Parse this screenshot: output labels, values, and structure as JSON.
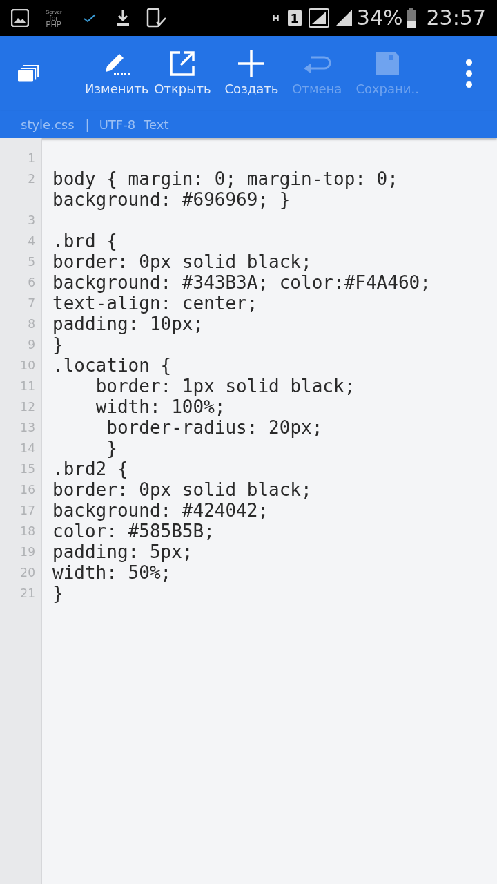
{
  "status_bar": {
    "notification_label": [
      "Server",
      "for",
      "PHP"
    ],
    "network_type": "H",
    "sim": "1",
    "battery": "34%",
    "time": "23:57"
  },
  "toolbar": {
    "actions": [
      {
        "kind": "edit",
        "label": "Изменить",
        "disabled": false
      },
      {
        "kind": "open",
        "label": "Открыть",
        "disabled": false
      },
      {
        "kind": "create",
        "label": "Создать",
        "disabled": false
      },
      {
        "kind": "undo",
        "label": "Отмена",
        "disabled": true
      },
      {
        "kind": "save",
        "label": "Сохрани..",
        "disabled": true
      }
    ]
  },
  "file_info": {
    "filename": "style.css",
    "separator": "|",
    "encoding": "UTF-8",
    "mode": "Text"
  },
  "editor": {
    "lines": [
      {
        "number": "1"
      },
      {
        "number": "2",
        "text": "body { margin: 0; margin-top: 0; background: #696969; }"
      },
      {
        "number": "3"
      },
      {
        "number": "4",
        "text": ".brd { "
      },
      {
        "number": "5",
        "text": "border: 0px solid black;"
      },
      {
        "number": "6",
        "text": "background: #343B3A; color:#F4A460; "
      },
      {
        "number": "7",
        "text": "text-align: center;"
      },
      {
        "number": "8",
        "text": "padding: 10px;"
      },
      {
        "number": "9",
        "text": "}"
      },
      {
        "number": "10",
        "text": ".location {"
      },
      {
        "number": "11",
        "text": "    border: 1px solid black;"
      },
      {
        "number": "12",
        "text": "    width: 100%;"
      },
      {
        "number": "13",
        "text": "     border-radius: 20px;"
      },
      {
        "number": "14",
        "text": "     }"
      },
      {
        "number": "15",
        "text": ".brd2 { "
      },
      {
        "number": "16",
        "text": "border: 0px solid black;"
      },
      {
        "number": "17",
        "text": "background: #424042; "
      },
      {
        "number": "18",
        "text": "color: #585B5B;"
      },
      {
        "number": "19",
        "text": "padding: 5px;"
      },
      {
        "number": "20",
        "text": "width: 50%;"
      },
      {
        "number": "21",
        "text": "}"
      }
    ]
  }
}
